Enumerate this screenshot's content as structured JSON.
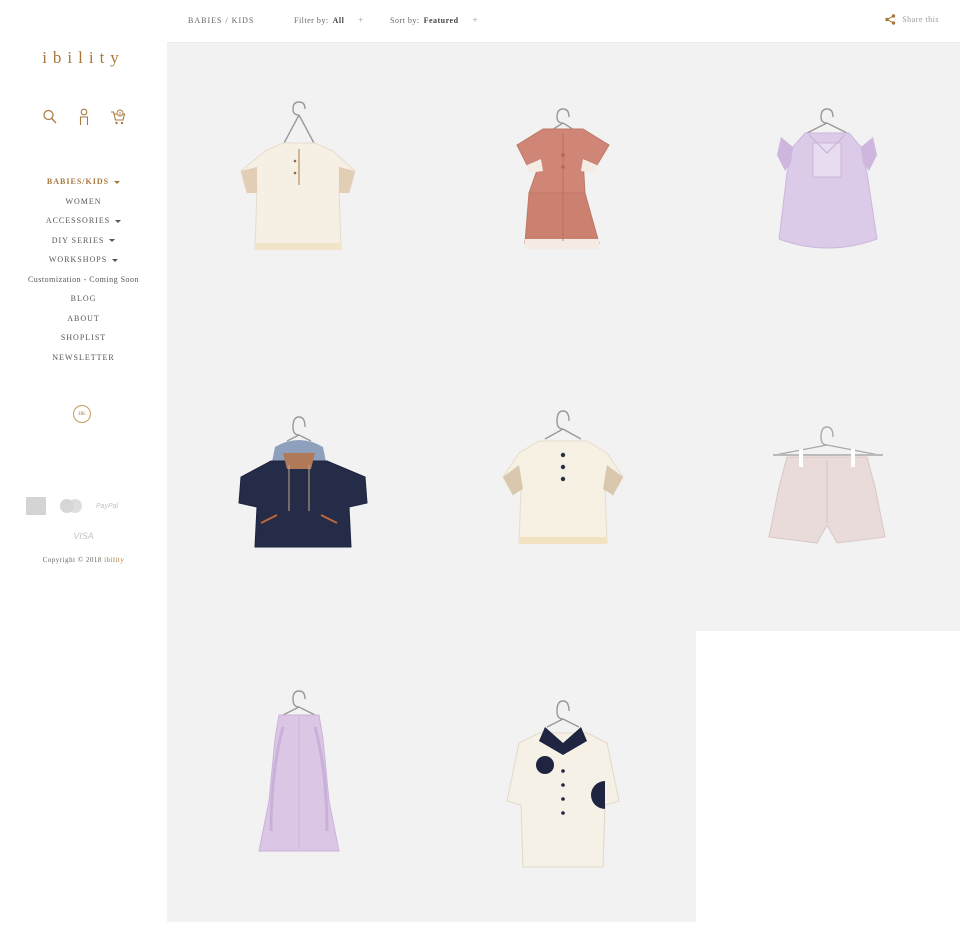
{
  "brand": {
    "logo": "ibility"
  },
  "sidebar": {
    "icons": [
      "search-icon",
      "account-icon",
      "cart-icon"
    ],
    "nav": [
      {
        "label": "BABIES/KIDS",
        "caret": true,
        "active": true
      },
      {
        "label": "WOMEN",
        "caret": false
      },
      {
        "label": "ACCESSORIES",
        "caret": true
      },
      {
        "label": "DIY SERIES",
        "caret": true
      },
      {
        "label": "WORKSHOPS",
        "caret": true
      },
      {
        "label": "Customization - Coming Soon",
        "caret": false
      },
      {
        "label": "BLOG",
        "caret": false
      },
      {
        "label": "ABOUT",
        "caret": false
      },
      {
        "label": "SHOPLIST",
        "caret": false
      },
      {
        "label": "NEWSLETTER",
        "caret": false
      }
    ],
    "region_badge": "HK",
    "payments": {
      "paypal": "PayPal",
      "visa": "VISA"
    },
    "copyright": {
      "prefix": "Copyright © 2018",
      "brand": "ibility"
    }
  },
  "topbar": {
    "breadcrumb": "BABIES / KIDS",
    "filter": {
      "label": "Filter by:",
      "value": "All",
      "toggle": "+"
    },
    "sort": {
      "label": "Sort by:",
      "value": "Featured",
      "toggle": "+"
    },
    "share_label": "Share this"
  },
  "products": [
    {
      "type": "cream-tee"
    },
    {
      "type": "rose-dress"
    },
    {
      "type": "lilac-blouse"
    },
    {
      "type": "navy-hoodie"
    },
    {
      "type": "cream-button-tee"
    },
    {
      "type": "pink-shorts"
    },
    {
      "type": "lilac-dress"
    },
    {
      "type": "dot-shirt"
    }
  ],
  "colors": {
    "accent": "#a8783e",
    "grid_bg": "#f2f2f2",
    "text": "#555555"
  }
}
